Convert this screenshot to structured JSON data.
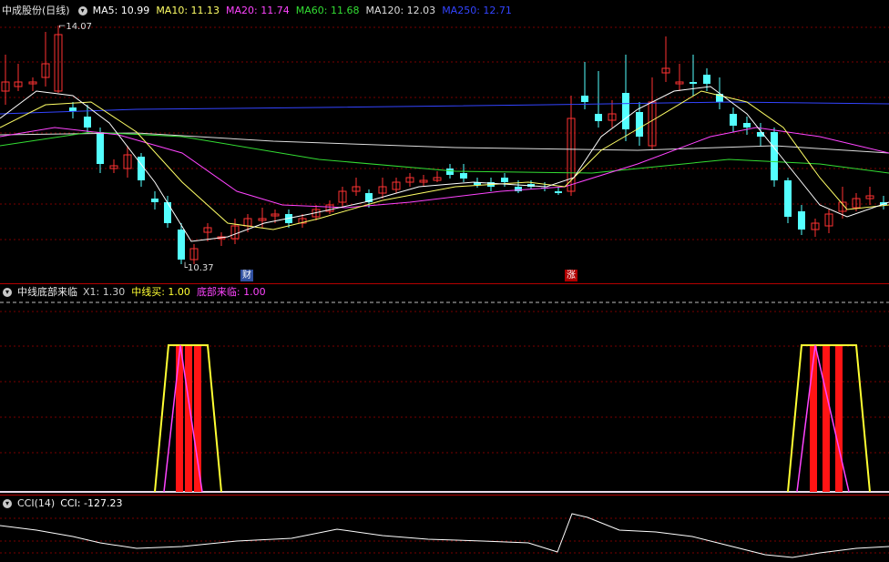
{
  "main": {
    "title": "中成股份(日线)",
    "ma": [
      {
        "label": "MA5: 10.99",
        "color": "#ffffff"
      },
      {
        "label": "MA10: 11.13",
        "color": "#ffff66"
      },
      {
        "label": "MA20: 11.74",
        "color": "#ff44ff"
      },
      {
        "label": "MA60: 11.68",
        "color": "#33dd33"
      },
      {
        "label": "MA120: 12.03",
        "color": "#dddddd"
      },
      {
        "label": "MA250: 12.71",
        "color": "#3344ff"
      }
    ],
    "high_label": "14.07",
    "low_label": "10.37",
    "marker_cai": "财",
    "marker_zhang": "涨"
  },
  "ind1": {
    "title": "中线底部来临",
    "items": [
      {
        "label": "X1: 1.30",
        "color": "#cccccc"
      },
      {
        "label": "中线买: 1.00",
        "color": "#ffff33"
      },
      {
        "label": "底部来临: 1.00",
        "color": "#ff44ff"
      }
    ]
  },
  "ind2": {
    "title": "CCI(14)",
    "items": [
      {
        "label": "CCI: -127.23",
        "color": "#ffffff"
      }
    ]
  },
  "colors": {
    "up": "#ff3232",
    "down": "#54ffff",
    "grid": "#7a0000",
    "divider": "#b40000"
  }
}
